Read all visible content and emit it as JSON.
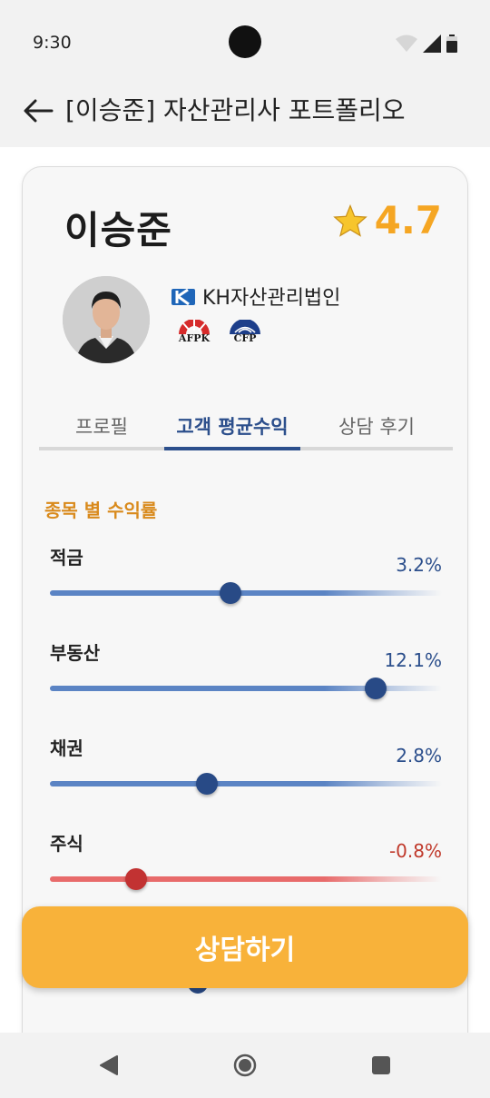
{
  "status_bar": {
    "time": "9:30"
  },
  "app_bar": {
    "title": "[이승준] 자산관리사 포트폴리오"
  },
  "advisor": {
    "name": "이승준",
    "rating": "4.7",
    "company": "KH자산관리법인",
    "badges": [
      "AFPK",
      "CFP"
    ]
  },
  "tabs": [
    {
      "label": "프로필",
      "active": false
    },
    {
      "label": "고객 평균수익",
      "active": true
    },
    {
      "label": "상담 후기",
      "active": false
    }
  ],
  "returns": {
    "section_title": "종목 별 수익률",
    "items": [
      {
        "label": "적금",
        "value": "3.2%",
        "level": 0.46,
        "negative": false
      },
      {
        "label": "부동산",
        "value": "12.1%",
        "level": 0.83,
        "negative": false
      },
      {
        "label": "채권",
        "value": "2.8%",
        "level": 0.4,
        "negative": false
      },
      {
        "label": "주식",
        "value": "-0.8%",
        "level": 0.22,
        "negative": true
      }
    ]
  },
  "actions": {
    "consult_label": "상담하기"
  },
  "colors": {
    "accent": "#2c4f8c",
    "rating": "#f5a623",
    "section": "#d98a1c",
    "negative": "#c0392b",
    "button": "#f8b23a"
  }
}
